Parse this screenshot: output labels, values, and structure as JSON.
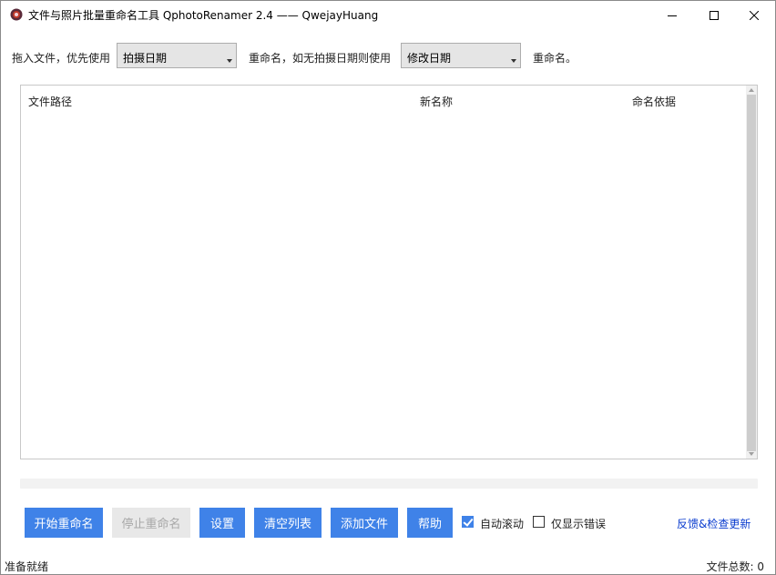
{
  "window": {
    "title": "文件与照片批量重命名工具 QphotoRenamer 2.4 —— QwejayHuang",
    "controls": [
      "minimize-icon",
      "maximize-icon",
      "close-icon"
    ]
  },
  "options_row": {
    "label_drag": "拖入文件，优先使用",
    "primary_date": "拍摄日期",
    "label_middle": "重命名，如无拍摄日期则使用",
    "fallback_date": "修改日期",
    "label_end": "重命名。"
  },
  "file_list": {
    "columns": [
      "文件路径",
      "新名称",
      "命名依据"
    ],
    "rows": []
  },
  "progress": {
    "value_percent": 0
  },
  "toolbar": {
    "start_label": "开始重命名",
    "stop_label": "停止重命名",
    "settings_label": "设置",
    "clear_label": "清空列表",
    "add_label": "添加文件",
    "help_label": "帮助",
    "auto_scroll_label": "自动滚动",
    "auto_scroll_checked": true,
    "errors_only_label": "仅显示错误",
    "errors_only_checked": false,
    "feedback_link": "反馈&检查更新"
  },
  "statusbar": {
    "status": "准备就绪",
    "file_count": "文件总数: 0"
  },
  "colors": {
    "accent": "#3f82e8",
    "link": "#0a3ccf",
    "disabled_bg": "#e8e8e8"
  }
}
